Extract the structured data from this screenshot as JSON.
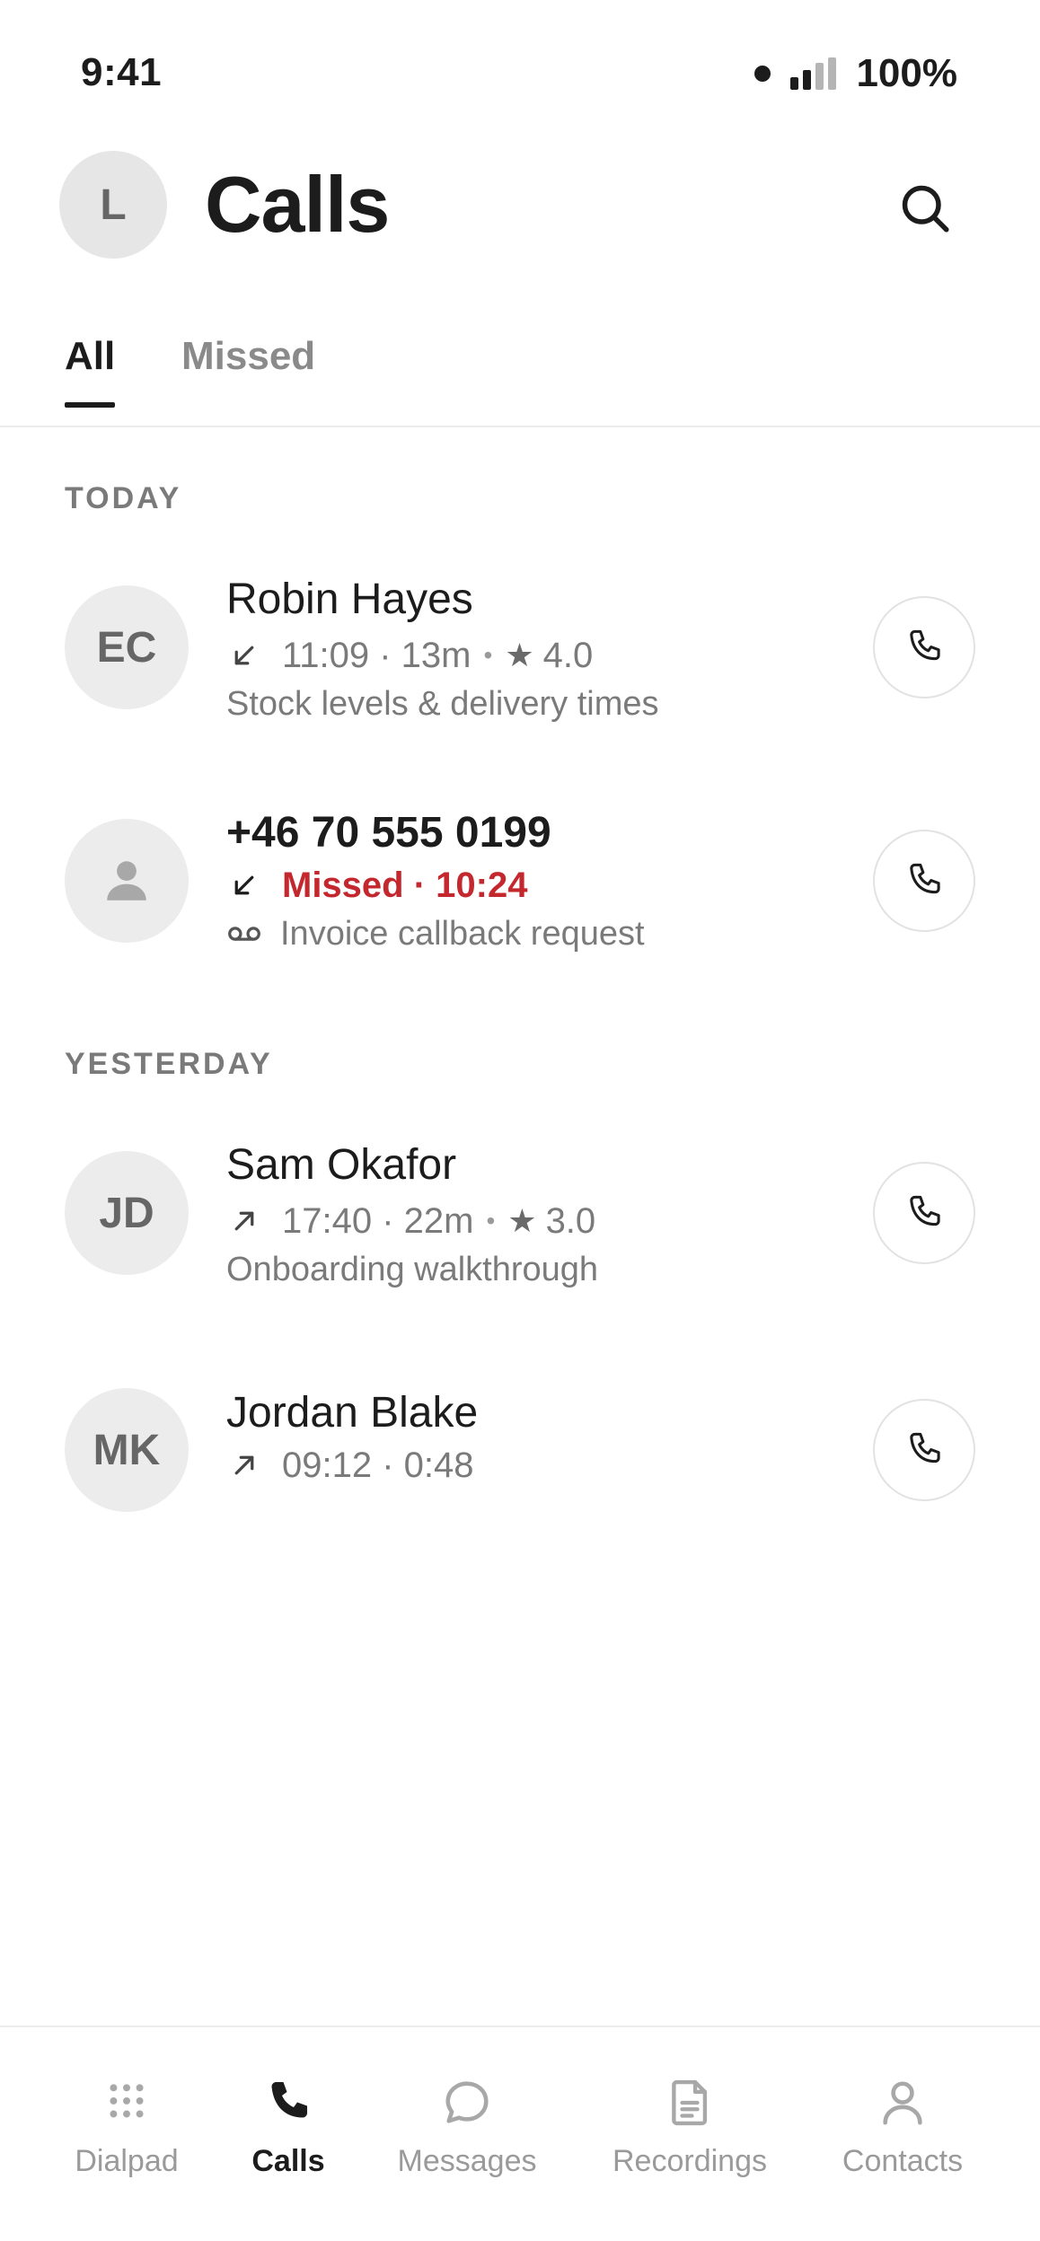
{
  "status_bar": {
    "time": "9:41",
    "battery": "100%"
  },
  "header": {
    "avatar_initial": "L",
    "title": "Calls"
  },
  "tabs": [
    {
      "label": "All",
      "active": true
    },
    {
      "label": "Missed",
      "active": false
    }
  ],
  "sections": [
    {
      "header": "TODAY",
      "calls": [
        {
          "initials": "EC",
          "name": "Robin Hayes",
          "direction": "incoming",
          "time_duration": "11:09 · 13m",
          "rating": "4.0",
          "note": "Stock levels & delivery times"
        },
        {
          "initials": "",
          "name": "+46 70 555 0199",
          "direction": "incoming",
          "missed_text": "Missed · 10:24",
          "voicemail_note": "Invoice callback request"
        }
      ]
    },
    {
      "header": "YESTERDAY",
      "calls": [
        {
          "initials": "JD",
          "name": "Sam Okafor",
          "direction": "outgoing",
          "time_duration": "17:40 · 22m",
          "rating": "3.0",
          "note": "Onboarding walkthrough"
        },
        {
          "initials": "MK",
          "name": "Jordan Blake",
          "direction": "outgoing",
          "time_duration": "09:12 · 0:48"
        }
      ]
    }
  ],
  "bottom_nav": [
    {
      "label": "Dialpad",
      "icon": "dialpad-icon",
      "active": false
    },
    {
      "label": "Calls",
      "icon": "phone-icon",
      "active": true
    },
    {
      "label": "Messages",
      "icon": "chat-bubble-icon",
      "active": false
    },
    {
      "label": "Recordings",
      "icon": "document-icon",
      "active": false
    },
    {
      "label": "Contacts",
      "icon": "person-icon",
      "active": false
    }
  ],
  "colors": {
    "missed": "#c4282f",
    "text": "#1c1c1c",
    "muted": "#7a7a7a",
    "avatar_bg": "#ececec"
  }
}
